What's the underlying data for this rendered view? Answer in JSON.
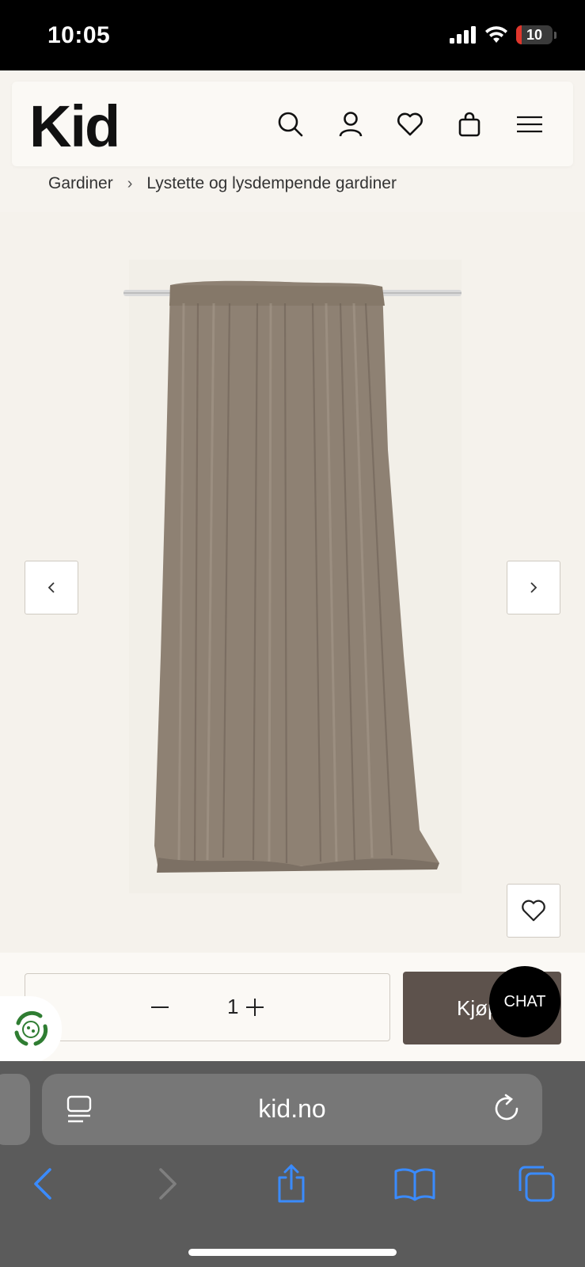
{
  "status_bar": {
    "time": "10:05",
    "battery_level": "10",
    "battery_fraction": 0.1,
    "icons": [
      "signal-icon",
      "wifi-icon",
      "battery-icon"
    ]
  },
  "header": {
    "logo": "Kid",
    "icons": [
      "search-icon",
      "account-icon",
      "heart-icon",
      "bag-icon",
      "menu-icon"
    ]
  },
  "breadcrumb": {
    "items": [
      "Gardiner",
      "Lystette og lysdempende gardiner"
    ],
    "separator": "›"
  },
  "product": {
    "image_icon": "curtain-product-image",
    "curtain_color": "#8e8173"
  },
  "buy_bar": {
    "quantity": "1",
    "minus": "−",
    "plus": "+",
    "buy_label": "Kjøp",
    "buy_color": "#5d524c"
  },
  "chat": {
    "label": "CHAT"
  },
  "browser": {
    "url": "kid.no",
    "accent": "#3a8bff",
    "toolbar": [
      "back-icon",
      "forward-icon",
      "share-icon",
      "bookmarks-icon",
      "tabs-icon"
    ]
  }
}
